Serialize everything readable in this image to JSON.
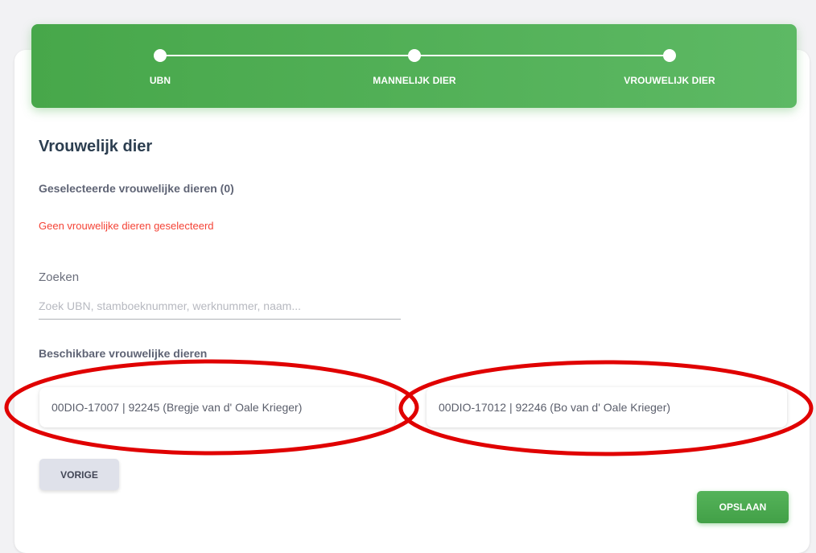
{
  "stepper": {
    "steps": [
      {
        "label": "UBN"
      },
      {
        "label": "MANNELIJK DIER"
      },
      {
        "label": "VROUWELIJK DIER"
      }
    ]
  },
  "page": {
    "title": "Vrouwelijk dier",
    "selected_heading": "Geselecteerde vrouwelijke dieren (0)",
    "empty_message": "Geen vrouwelijke dieren geselecteerd",
    "available_heading": "Beschikbare vrouwelijke dieren"
  },
  "search": {
    "label": "Zoeken",
    "placeholder": "Zoek UBN, stamboeknummer, werknummer, naam...",
    "value": ""
  },
  "animals": [
    {
      "text": "00DIO-17007 | 92245 (Bregje van d' Oale Krieger)"
    },
    {
      "text": "00DIO-17012 | 92246 (Bo van d' Oale Krieger)"
    }
  ],
  "buttons": {
    "previous_label": "VORIGE",
    "save_label": "OPSLAAN"
  },
  "colors": {
    "primary_green": "#4caf50",
    "error_red": "#f44336",
    "annotation_red": "#e00000"
  },
  "icons": {
    "step_marker": "white-dot"
  }
}
